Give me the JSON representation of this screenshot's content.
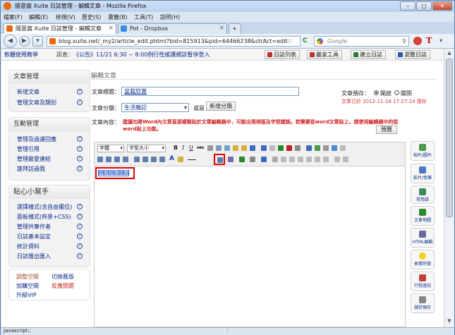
{
  "window": {
    "title": "隨意窩 Xuite 日誌管理 - 編輯文章 - Mozilla Firefox",
    "min": "–",
    "max": "□",
    "close": "✕"
  },
  "menu": [
    "檔案(F)",
    "編輯(E)",
    "檢視(V)",
    "歷史(S)",
    "書籤(B)",
    "工具(T)",
    "說明(H)"
  ],
  "tabs": [
    {
      "label": "隨意窩 Xuite 日誌管理 - 編輯文章",
      "close": "×"
    },
    {
      "label": "Pot - Dropbox",
      "close": "×"
    },
    {
      "label": "+"
    }
  ],
  "nav": {
    "back": "◀",
    "forward": "▶",
    "url": "blog.xuite.net/_my2/article_edit.phtml?bid=815913&pid=64466238&strAct=edit",
    "search_placeholder": "Google",
    "star": "☆",
    "reload": "C"
  },
  "strip": {
    "help": "軟體使用教學",
    "notice": "訊息：",
    "notice_text": "《公告》11/21 6:30 ~ 8:00例行性維護網誌暫停登入",
    "buttons": [
      "日誌列表",
      "搬家工具",
      "建立日誌",
      "瀏覽日誌"
    ]
  },
  "sidebar": {
    "s1": {
      "title": "文章管理",
      "items": [
        "新增文章",
        "管理文章及類別"
      ]
    },
    "s2": {
      "title": "互動管理",
      "items": [
        "管理及過濾回應",
        "管理引用",
        "管理最愛連結",
        "誰拜訪過我"
      ]
    },
    "s3": {
      "title": "貼心小幫手",
      "items": [
        "選擇樣式(含自由擺位)",
        "面板樣式(佈景+CSS)",
        "管理共筆作者",
        "日誌基本設定",
        "統計資料",
        "日誌匯出匯入"
      ]
    },
    "bottom": {
      "a": "調整空間",
      "b": "切換舊版",
      "c": "加購空間",
      "d": "反應問題",
      "e": "升級VIP"
    },
    "q": "?"
  },
  "editor": {
    "heading": "編輯文章",
    "title_label": "文章標題：",
    "title_value": "盆栽欣賞",
    "cat_label": "文章分類：",
    "cat_value": "生活雜記",
    "or": "或是",
    "new_cat": "新增分類",
    "preview_label": "文章預存：",
    "on": "開啟",
    "off": "關閉",
    "saved": "文章已於 2012-11-18 17:27:24 預存",
    "content_label": "文章內容：",
    "warning": "建議勿將Word內文章直接複製貼於文章編輯器中，可能出現排版及字型錯誤。若需要從word文章貼上，請使用編輯器中的從word貼上功能。",
    "preview_btn": "預覽",
    "font": "字體",
    "size": "字型大小",
    "bold": "B",
    "italic": "I",
    "underline": "U",
    "strike": "ABC",
    "body_text": "盆栽相簿欣賞"
  },
  "right": [
    "相片/圖片",
    "影片/音樂",
    "常用語",
    "文章地圖",
    "HTML編輯",
    "表情符號",
    "行程遊記",
    "儲存預存"
  ],
  "status": "Javascript:;"
}
